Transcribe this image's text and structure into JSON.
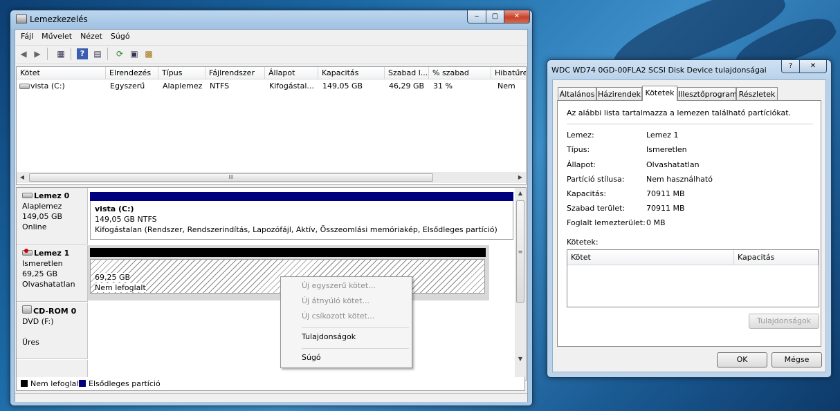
{
  "disk_mgmt": {
    "title": "Lemezkezelés",
    "caption_buttons": {
      "minimize": "‒",
      "maximize": "▢",
      "close": "✕"
    },
    "menu": [
      "Fájl",
      "Művelet",
      "Nézet",
      "Súgó"
    ],
    "toolbar_icons": [
      "back-icon",
      "forward-icon",
      "console-tree-icon",
      "help-icon",
      "show-hide-icon",
      "refresh-icon",
      "properties-icon",
      "rescan-disks-icon"
    ],
    "columns": [
      "Kötet",
      "Elrendezés",
      "Típus",
      "Fájlrendszer",
      "Állapot",
      "Kapacitás",
      "Szabad l...",
      "% szabad",
      "Hibatűre"
    ],
    "volumes": [
      {
        "name": "vista (C:)",
        "layout": "Egyszerű",
        "type": "Alaplemez",
        "fs": "NTFS",
        "status": "Kifogástal...",
        "capacity": "149,05 GB",
        "free": "46,29 GB",
        "pct_free": "31 %",
        "fault_tolerance": "Nem"
      }
    ],
    "disks": [
      {
        "title": "Lemez 0",
        "type": "Alaplemez",
        "size": "149,05 GB",
        "state": "Online",
        "partition": {
          "name": "vista  (C:)",
          "size_fs": "149,05 GB NTFS",
          "status": "Kifogástalan (Rendszer, Rendszerindítás, Lapozófájl, Aktív, Összeomlási memóriakép, Elsődleges partíció)"
        }
      },
      {
        "title": "Lemez 1",
        "type": "Ismeretlen",
        "size": "69,25 GB",
        "state": "Olvashatatlan",
        "partition": {
          "size": "69,25 GB",
          "status": "Nem lefoglalt"
        }
      },
      {
        "title": "CD-ROM 0",
        "type": "DVD (F:)",
        "state": "Üres"
      }
    ],
    "legend": [
      {
        "label": "Nem lefoglalt",
        "color": "#000000"
      },
      {
        "label": "Elsődleges partíció",
        "color": "#00007f"
      }
    ],
    "context_menu": {
      "new_simple": "Új egyszerű kötet...",
      "new_spanned": "Új átnyúló kötet...",
      "new_striped": "Új csíkozott kötet...",
      "properties": "Tulajdonságok",
      "help": "Súgó"
    },
    "scroll_glyph": "III"
  },
  "properties_dialog": {
    "title": "WDC WD74 0GD-00FLA2 SCSI Disk Device tulajdonságai",
    "caption_buttons": {
      "help": "?",
      "close": "✕"
    },
    "tabs": [
      "Általános",
      "Házirendek",
      "Kötetek",
      "Illesztőprogram",
      "Részletek"
    ],
    "active_tab": "Kötetek",
    "description": "Az alábbi lista tartalmazza a lemezen található partíciókat.",
    "props": [
      {
        "label": "Lemez:",
        "value": "Lemez 1"
      },
      {
        "label": "Típus:",
        "value": "Ismeretlen"
      },
      {
        "label": "Állapot:",
        "value": "Olvashatatlan"
      },
      {
        "label": "Partíció stílusa:",
        "value": "Nem használható"
      },
      {
        "label": "Kapacitás:",
        "value": "70911 MB"
      },
      {
        "label": "Szabad terület:",
        "value": "70911 MB"
      },
      {
        "label": "Foglalt lemezterület:",
        "value": "0 MB"
      }
    ],
    "volumes_label": "Kötetek:",
    "volume_columns": [
      "Kötet",
      "Kapacitás"
    ],
    "properties_button": "Tulajdonságok",
    "ok_button": "OK",
    "cancel_button": "Mégse"
  }
}
